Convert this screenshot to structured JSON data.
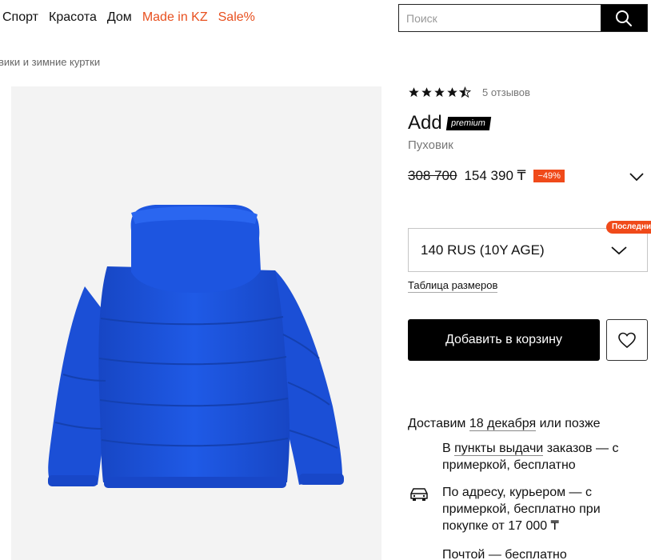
{
  "nav": {
    "items": [
      {
        "label": "Спорт",
        "accent": false
      },
      {
        "label": "Красота",
        "accent": false
      },
      {
        "label": "Дом",
        "accent": false
      },
      {
        "label": "Made in KZ",
        "accent": true
      },
      {
        "label": "Sale%",
        "accent": true
      }
    ]
  },
  "search": {
    "placeholder": "Поиск",
    "icon": "search-icon"
  },
  "breadcrumb": "вики и зимние куртки",
  "product": {
    "rating": 4.5,
    "reviews": "5 отзывов",
    "brand": "Add",
    "badge": "premium",
    "type": "Пуховик",
    "old_price": "308 700",
    "price": "154 390 ₸",
    "discount": "−49%",
    "last_badge": "Последний",
    "size": "140 RUS (10Y AGE)",
    "size_table": "Таблица размеров",
    "add_to_cart": "Добавить в корзину",
    "jacket_color": "#1a52d9"
  },
  "delivery": {
    "prefix": "Доставим",
    "date": "18 декабря",
    "suffix": "или позже",
    "options": [
      {
        "pre": "В",
        "link": "пункты выдачи",
        "rest": "заказов — с примеркой, бесплатно"
      },
      {
        "text": "По адресу, курьером — с примеркой, бесплатно при покупке от 17 000 ₸",
        "icon": "car-icon"
      },
      {
        "text": "Почтой — бесплатно"
      }
    ]
  },
  "colors": {
    "accent": "#e8501f",
    "discount": "#f04a1a",
    "button": "#000000"
  }
}
